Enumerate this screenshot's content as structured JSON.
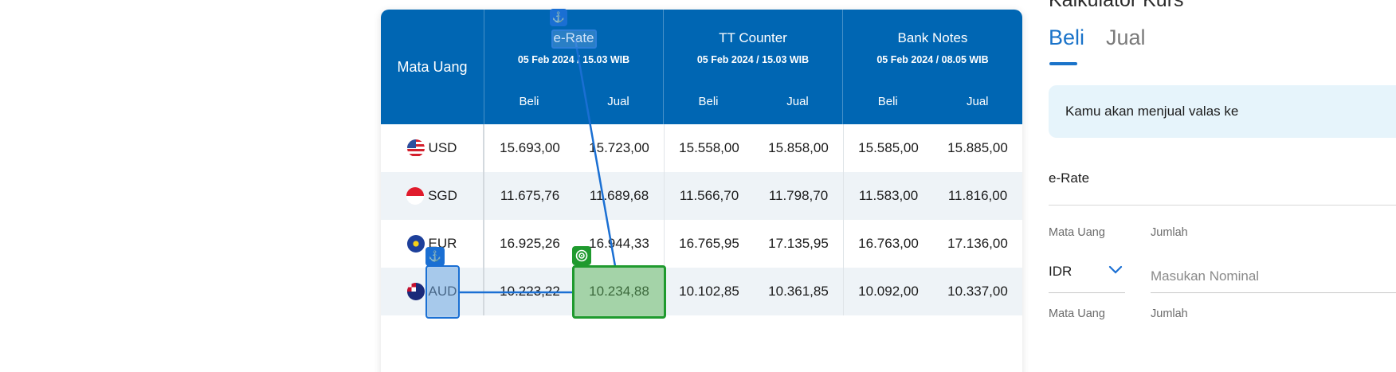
{
  "table": {
    "header": {
      "currency_label": "Mata Uang",
      "groups": [
        {
          "title": "e-Rate",
          "time": "05 Feb 2024 / 15.03 WIB",
          "beli": "Beli",
          "jual": "Jual"
        },
        {
          "title": "TT Counter",
          "time": "05 Feb 2024 / 15.03 WIB",
          "beli": "Beli",
          "jual": "Jual"
        },
        {
          "title": "Bank Notes",
          "time": "05 Feb 2024 / 08.05 WIB",
          "beli": "Beli",
          "jual": "Jual"
        }
      ]
    },
    "rows": [
      {
        "code": "USD",
        "flag": "us-flag-icon",
        "values": [
          "15.693,00",
          "15.723,00",
          "15.558,00",
          "15.858,00",
          "15.585,00",
          "15.885,00"
        ]
      },
      {
        "code": "SGD",
        "flag": "sg-flag-icon",
        "values": [
          "11.675,76",
          "11.689,68",
          "11.566,70",
          "11.798,70",
          "11.583,00",
          "11.816,00"
        ]
      },
      {
        "code": "EUR",
        "flag": "eu-flag-icon",
        "values": [
          "16.925,26",
          "16.944,33",
          "16.765,95",
          "17.135,95",
          "16.763,00",
          "17.136,00"
        ]
      },
      {
        "code": "AUD",
        "flag": "au-flag-icon",
        "values": [
          "10.223,22",
          "10.234,88",
          "10.102,85",
          "10.361,85",
          "10.092,00",
          "10.337,00"
        ]
      }
    ]
  },
  "calculator": {
    "title": "Kalkulator Kurs",
    "tabs": [
      {
        "label": "Beli",
        "active": true
      },
      {
        "label": "Jual",
        "active": false
      }
    ],
    "info_text": "Kamu akan menjual valas ke",
    "rate_type": "e-Rate",
    "from": {
      "currency_label": "Mata Uang",
      "amount_label": "Jumlah",
      "currency_value": "IDR",
      "amount_placeholder": "Masukan Nominal"
    },
    "to": {
      "currency_label": "Mata Uang",
      "amount_label": "Jumlah"
    }
  },
  "overlay": {
    "anchor_icon": "anchor-icon",
    "target_icon": "target-icon",
    "colors": {
      "anchor": "#1a6fd3",
      "target": "#1f9a2e",
      "header": "#0066b3",
      "accent": "#1a73c9"
    }
  }
}
